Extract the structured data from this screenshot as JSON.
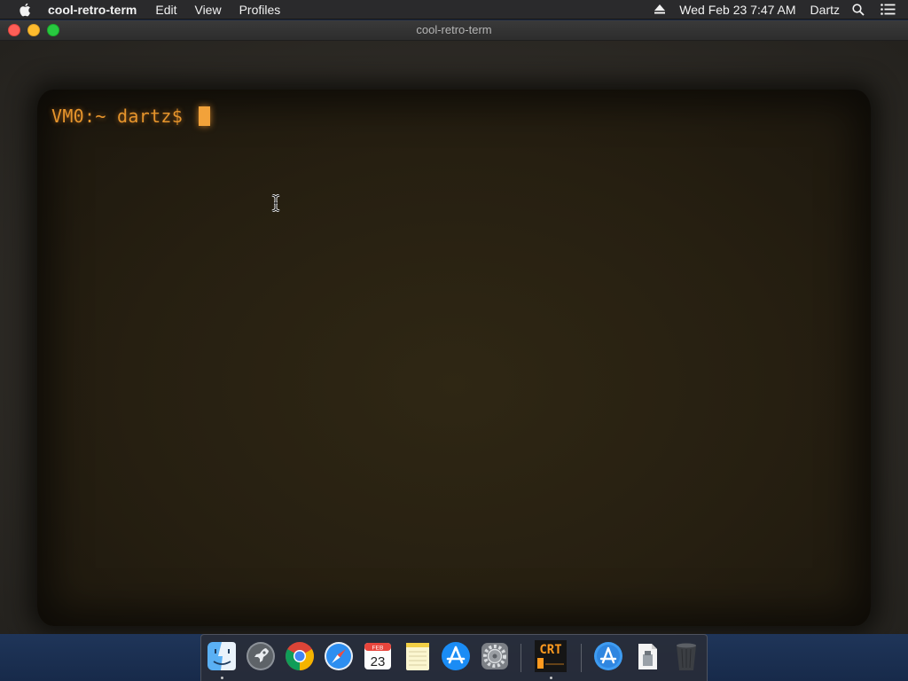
{
  "menubar": {
    "app_name": "cool-retro-term",
    "menus": [
      "Edit",
      "View",
      "Profiles"
    ],
    "clock": "Wed Feb 23  7:47 AM",
    "user": "Dartz",
    "icons": [
      "apple-icon",
      "eject-icon",
      "spotlight-search-icon",
      "notification-center-icon"
    ]
  },
  "window": {
    "title": "cool-retro-term",
    "terminal": {
      "prompt": "VM0:~ dartz$ ",
      "phosphor_color": "#e7952c"
    }
  },
  "dock": {
    "apps": [
      {
        "name": "Finder",
        "icon": "finder-icon",
        "running": true
      },
      {
        "name": "Launchpad",
        "icon": "launchpad-rocket-icon",
        "running": false
      },
      {
        "name": "Google Chrome",
        "icon": "chrome-icon",
        "running": false
      },
      {
        "name": "Safari",
        "icon": "safari-compass-icon",
        "running": false
      },
      {
        "name": "Calendar",
        "icon": "calendar-icon",
        "running": false,
        "month": "FEB",
        "day": "23"
      },
      {
        "name": "Notes",
        "icon": "notes-icon",
        "running": false
      },
      {
        "name": "App Store",
        "icon": "app-store-icon",
        "running": false
      },
      {
        "name": "System Preferences",
        "icon": "gear-icon",
        "running": false
      },
      {
        "name": "cool-retro-term",
        "icon": "crt-icon",
        "running": true,
        "label": "CRT"
      },
      {
        "name": "Applications",
        "icon": "applications-folder-icon",
        "running": false
      },
      {
        "name": "Downloads",
        "icon": "document-stack-icon",
        "running": false
      },
      {
        "name": "Trash",
        "icon": "trash-icon",
        "running": false
      }
    ]
  }
}
